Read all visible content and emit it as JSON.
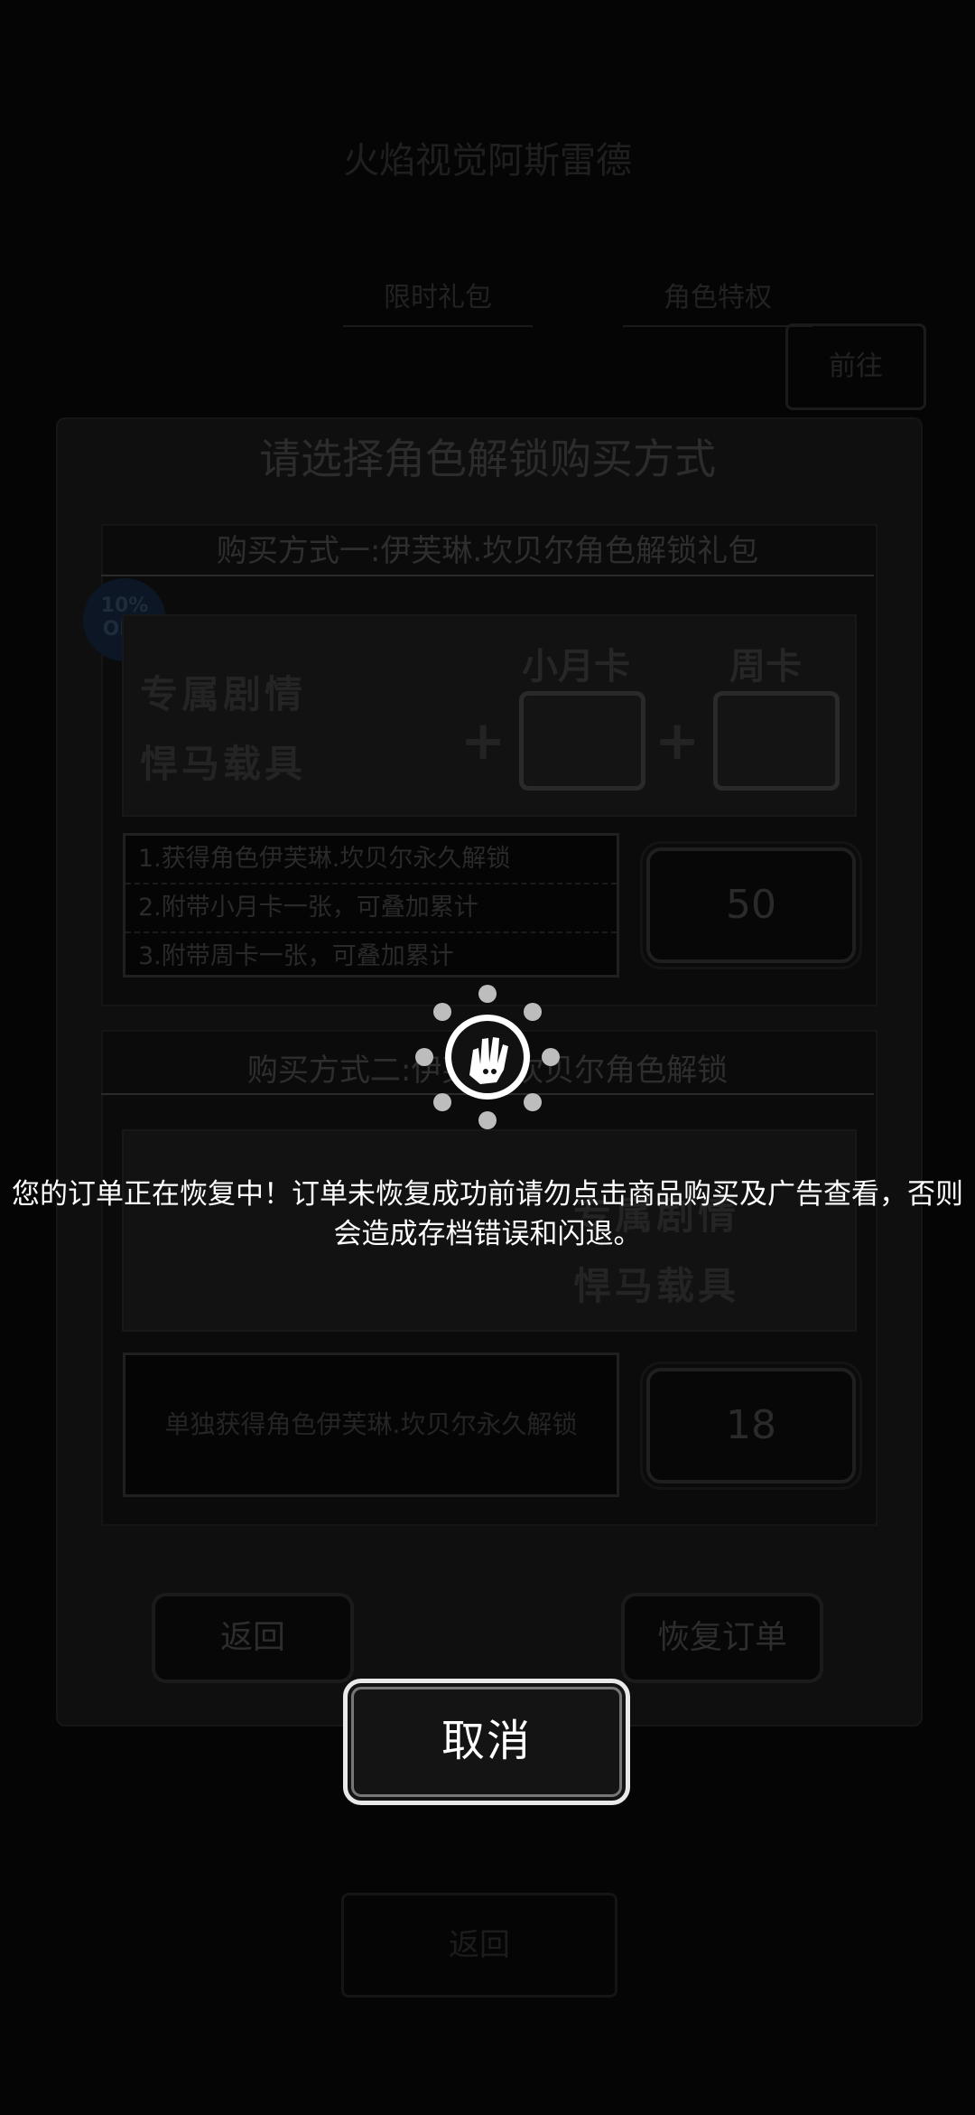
{
  "background": {
    "header_title": "火焰视觉阿斯雷德",
    "tabs": [
      "限时礼包",
      "角色特权"
    ],
    "corner_button": "前往",
    "footer_button": "返回"
  },
  "purchase_dialog": {
    "title": "请选择角色解锁购买方式",
    "option1": {
      "title": "购买方式一:伊芙琳.坎贝尔角色解锁礼包",
      "badge": "10% OFF",
      "banner_left_lines": [
        "专属剧情",
        "悍马载具"
      ],
      "card1_label": "小月卡",
      "card2_label": "周卡",
      "descriptions": [
        "1.获得角色伊芙琳.坎贝尔永久解锁",
        "2.附带小月卡一张，可叠加累计",
        "3.附带周卡一张，可叠加累计"
      ],
      "price": "50"
    },
    "option2": {
      "title": "购买方式二:伊芙琳.坎贝尔角色解锁",
      "banner_right_lines": [
        "专属剧情",
        "悍马载具"
      ],
      "description": "单独获得角色伊芙琳.坎贝尔永久解锁",
      "price": "18"
    },
    "back_button": "返回",
    "restore_button": "恢复订单"
  },
  "overlay": {
    "message": "您的订单正在恢复中！订单未恢复成功前请勿点击商品购买及广告查看，否则会造成存档错误和闪退。",
    "cancel_button": "取消"
  }
}
